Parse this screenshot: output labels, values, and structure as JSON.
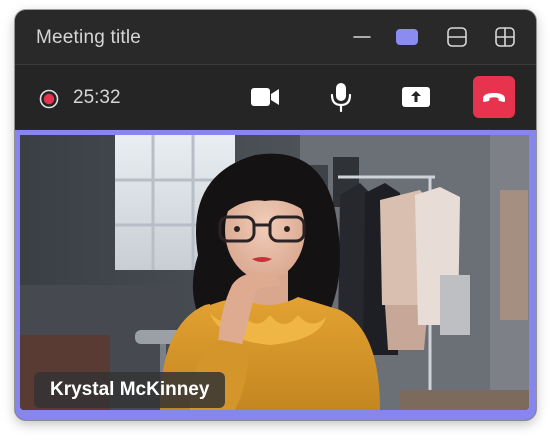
{
  "window": {
    "title": "Meeting title"
  },
  "window_controls": {
    "minimize": "minimize-icon",
    "active_view": "single-view-icon",
    "split_view": "split-view-icon",
    "grid_view": "grid-view-icon",
    "active_color": "#8b8cf1"
  },
  "controls": {
    "recording_icon": "record-icon",
    "timer": "25:32",
    "camera": "video-camera-icon",
    "mic": "microphone-icon",
    "share": "share-screen-icon",
    "hangup": "hang-up-icon",
    "hangup_color": "#e8334e"
  },
  "participant": {
    "name": "Krystal McKinney"
  },
  "colors": {
    "frame_border": "#8686ee",
    "titlebar_bg": "#292929"
  }
}
